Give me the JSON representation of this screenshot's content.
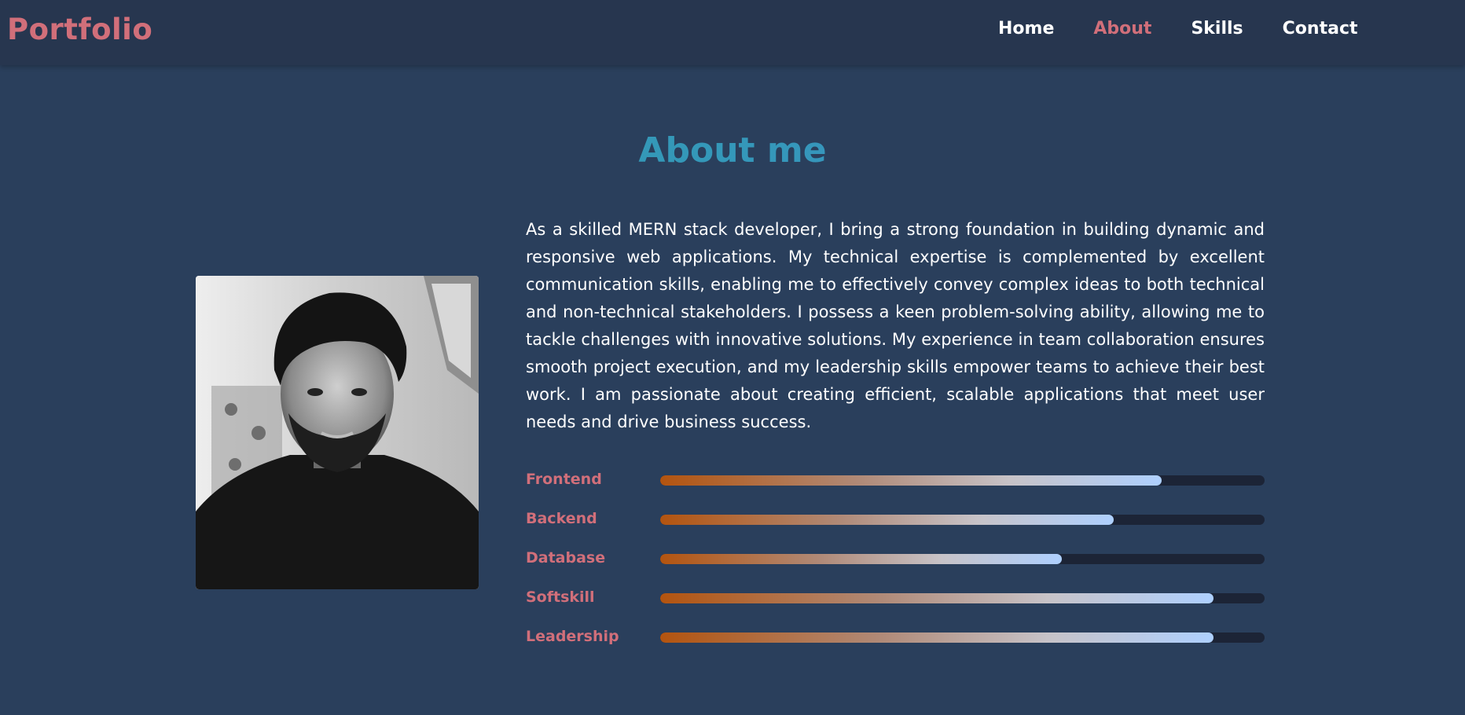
{
  "nav": {
    "brand": "Portfolio",
    "links": [
      {
        "label": "Home",
        "active": false
      },
      {
        "label": "About",
        "active": true
      },
      {
        "label": "Skills",
        "active": false
      },
      {
        "label": "Contact",
        "active": false
      }
    ]
  },
  "about": {
    "title": "About me",
    "paragraph": "As a skilled MERN stack developer, I bring a strong foundation in building dynamic and responsive web applications. My technical expertise is complemented by excellent communication skills, enabling me to effectively convey complex ideas to both technical and non-technical stakeholders. I possess a keen problem-solving ability, allowing me to tackle challenges with innovative solutions. My experience in team collaboration ensures smooth project execution, and my leadership skills empower teams to achieve their best work. I am passionate about creating efficient, scalable applications that meet user needs and drive business success.",
    "photo_description": "profile-photo"
  },
  "skills": [
    {
      "label": "Frontend",
      "level": 0.83
    },
    {
      "label": "Backend",
      "level": 0.75
    },
    {
      "label": "Database",
      "level": 0.665
    },
    {
      "label": "Softskill",
      "level": 0.915
    },
    {
      "label": "Leadership",
      "level": 0.915
    }
  ],
  "colors": {
    "background": "#2a3f5c",
    "navbar": "#27364f",
    "accent": "#d16f7a",
    "title": "#3a9eb5",
    "track": "#1c2436",
    "fill_start": "#b3540f",
    "fill_end": "#aed0ff"
  }
}
